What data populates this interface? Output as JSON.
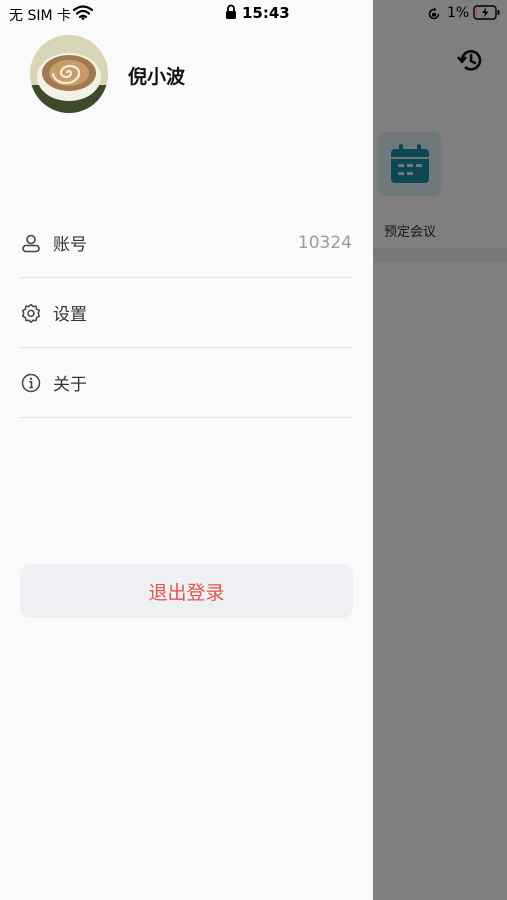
{
  "status_bar": {
    "carrier": "无 SIM 卡",
    "time": "15:43",
    "battery_percent": "1%",
    "icons": [
      "wifi-icon",
      "lock-icon",
      "rotation-lock-icon",
      "battery-charging-icon"
    ]
  },
  "drawer": {
    "user_name": "倪小波",
    "avatar_icon": "avatar-coffee-image",
    "menu": [
      {
        "label": "账号",
        "value": "10324",
        "icon": "user-icon"
      },
      {
        "label": "设置",
        "icon": "gear-icon"
      },
      {
        "label": "关于",
        "icon": "info-icon"
      }
    ],
    "logout_label": "退出登录"
  },
  "background_app": {
    "history_icon": "history-icon",
    "tile_label": "预定会议",
    "tile_icon": "calendar-icon"
  },
  "colors": {
    "logout_text": "#e2554c",
    "tile_accent": "#1a8fa5",
    "overlay": "rgba(0,0,0,0.5)"
  }
}
